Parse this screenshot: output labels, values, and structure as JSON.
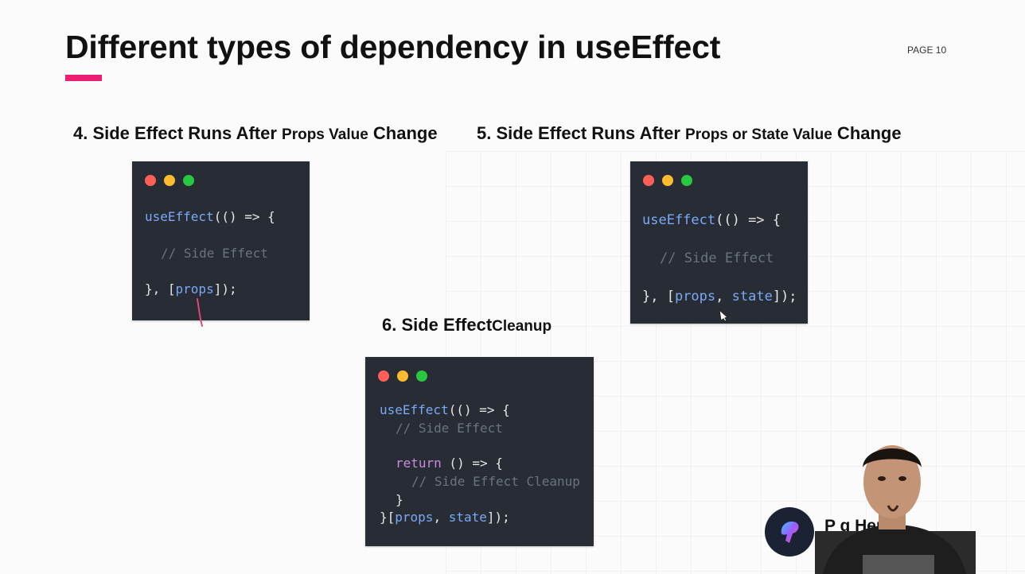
{
  "slide": {
    "title": "Different types of dependency in useEffect",
    "page_label": "PAGE 10",
    "accent_color": "#ec1f73"
  },
  "sections": [
    {
      "heading_main_a": "4. Side Effect Runs After ",
      "heading_small": "Props Value",
      "heading_main_b": " Change",
      "code": {
        "l1_fn": "useEffect",
        "l1_rest": "(() => {",
        "l2_comment": "// Side Effect",
        "l3_a": "}, [",
        "l3_var": "props",
        "l3_b": "]);"
      }
    },
    {
      "heading_main_a": "5. Side Effect Runs After ",
      "heading_small": "Props or State Value",
      "heading_main_b": " Change",
      "code": {
        "l1_fn": "useEffect",
        "l1_rest": "(() => {",
        "l2_comment": "// Side Effect",
        "l3_a": "}, [",
        "l3_var1": "props",
        "l3_sep": ", ",
        "l3_var2": "state",
        "l3_b": "]);"
      }
    },
    {
      "heading_main": "6. Side Effect",
      "heading_small": "Cleanup",
      "code": {
        "l1_fn": "useEffect",
        "l1_rest": "(() => {",
        "l2_comment": "// Side Effect",
        "l3_kw": "return",
        "l3_rest": " () => {",
        "l4_comment": "// Side Effect Cleanup",
        "l5": "}",
        "l6_a": "}[",
        "l6_var1": "props",
        "l6_sep": ", ",
        "l6_var2": "state",
        "l6_b": "]);"
      }
    }
  ],
  "watermark": {
    "brand_text": "P                   g Hero",
    "logo_icon": "react-brush-logo-icon"
  },
  "icons": {
    "window_controls": [
      "red-dot-icon",
      "yellow-dot-icon",
      "green-dot-icon"
    ],
    "cursor": "pen-cursor-icon"
  }
}
